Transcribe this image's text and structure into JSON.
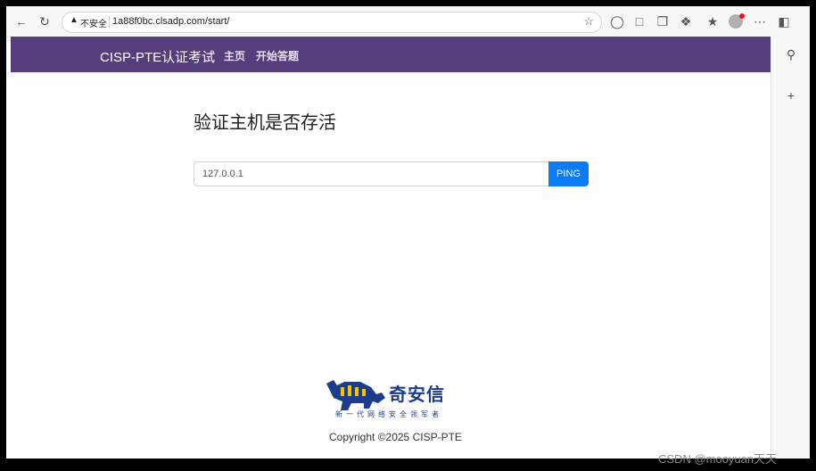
{
  "browser": {
    "security_icon": "warning-triangle-icon",
    "security_label": "不安全",
    "url": "1a88f0bc.clsadp.com/start/"
  },
  "navbar": {
    "brand": "CISP-PTE认证考试",
    "links": [
      "主页",
      "开始答题"
    ]
  },
  "main": {
    "heading": "验证主机是否存活",
    "input_value": "127.0.0.1",
    "button_label": "PING"
  },
  "footer": {
    "logo_text": "奇安信",
    "logo_subtitle": "新一代网络安全领军者",
    "copyright": "Copyright ©2025 CISP-PTE"
  },
  "watermark": "CSDN @mooyuan天天",
  "colors": {
    "navbar": "#563d7c",
    "button": "#0d7cf2",
    "logo": "#1c3e8a"
  }
}
